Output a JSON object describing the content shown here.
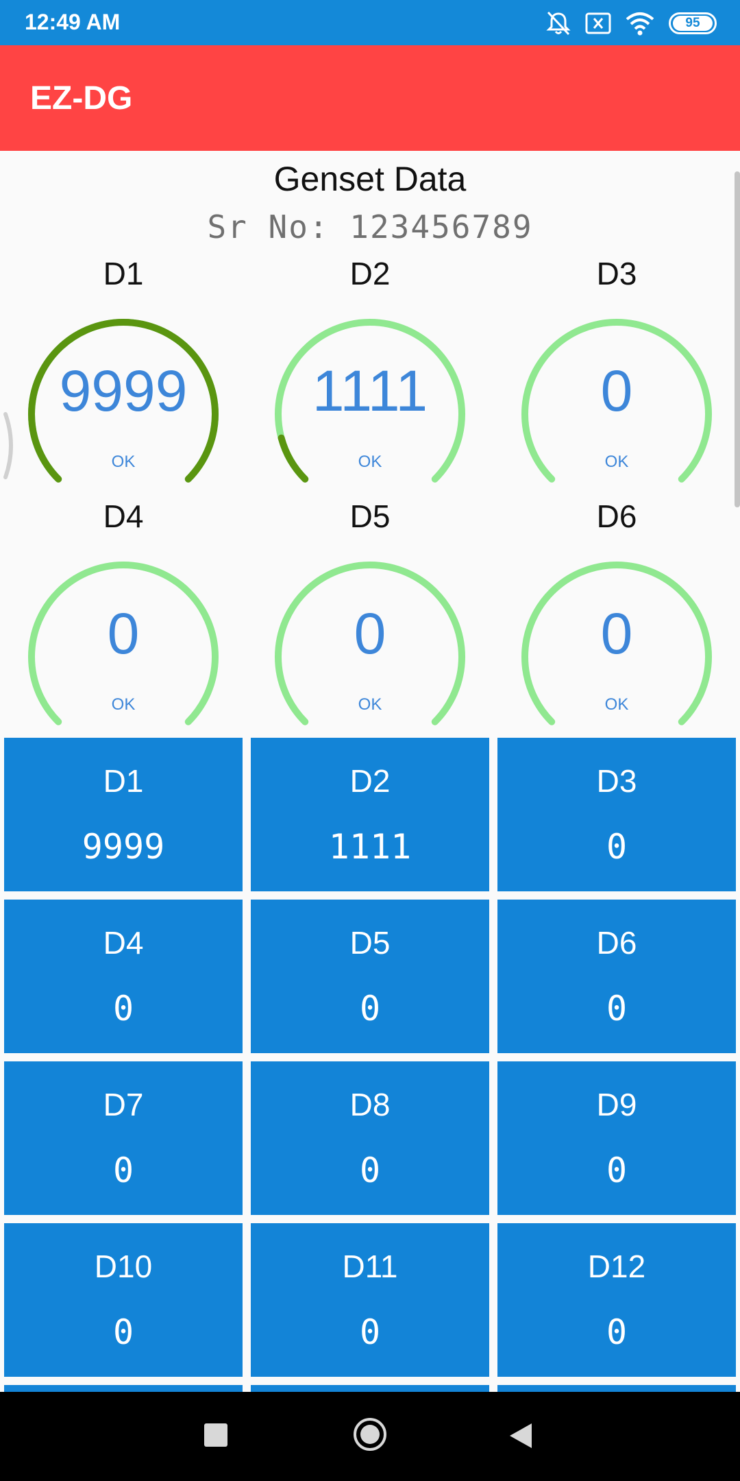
{
  "status_bar": {
    "time": "12:49 AM",
    "battery": "95",
    "icons": [
      "notifications-off-icon",
      "sim-error-icon",
      "wifi-icon",
      "battery-icon"
    ]
  },
  "app_bar": {
    "title": "EZ-DG"
  },
  "page": {
    "title": "Genset Data",
    "serial": "Sr No: 123456789"
  },
  "colors": {
    "status_bar": "#1489d8",
    "app_bar": "#ff4444",
    "tile": "#1384d7",
    "gauge_track": "#90e890",
    "gauge_fill": "#5a9510",
    "gauge_text": "#3d86d9"
  },
  "gauges": [
    {
      "label": "D1",
      "value": "9999",
      "status": "OK",
      "fill_fraction": 1.0
    },
    {
      "label": "D2",
      "value": "1111",
      "status": "OK",
      "fill_fraction": 0.111
    },
    {
      "label": "D3",
      "value": "0",
      "status": "OK",
      "fill_fraction": 0
    },
    {
      "label": "D4",
      "value": "0",
      "status": "OK",
      "fill_fraction": 0
    },
    {
      "label": "D5",
      "value": "0",
      "status": "OK",
      "fill_fraction": 0
    },
    {
      "label": "D6",
      "value": "0",
      "status": "OK",
      "fill_fraction": 0
    }
  ],
  "tiles": [
    {
      "label": "D1",
      "value": "9999"
    },
    {
      "label": "D2",
      "value": "1111"
    },
    {
      "label": "D3",
      "value": "0"
    },
    {
      "label": "D4",
      "value": "0"
    },
    {
      "label": "D5",
      "value": "0"
    },
    {
      "label": "D6",
      "value": "0"
    },
    {
      "label": "D7",
      "value": "0"
    },
    {
      "label": "D8",
      "value": "0"
    },
    {
      "label": "D9",
      "value": "0"
    },
    {
      "label": "D10",
      "value": "0"
    },
    {
      "label": "D11",
      "value": "0"
    },
    {
      "label": "D12",
      "value": "0"
    }
  ],
  "nav_bar": {
    "buttons": [
      "recents-button",
      "home-button",
      "back-button"
    ]
  }
}
